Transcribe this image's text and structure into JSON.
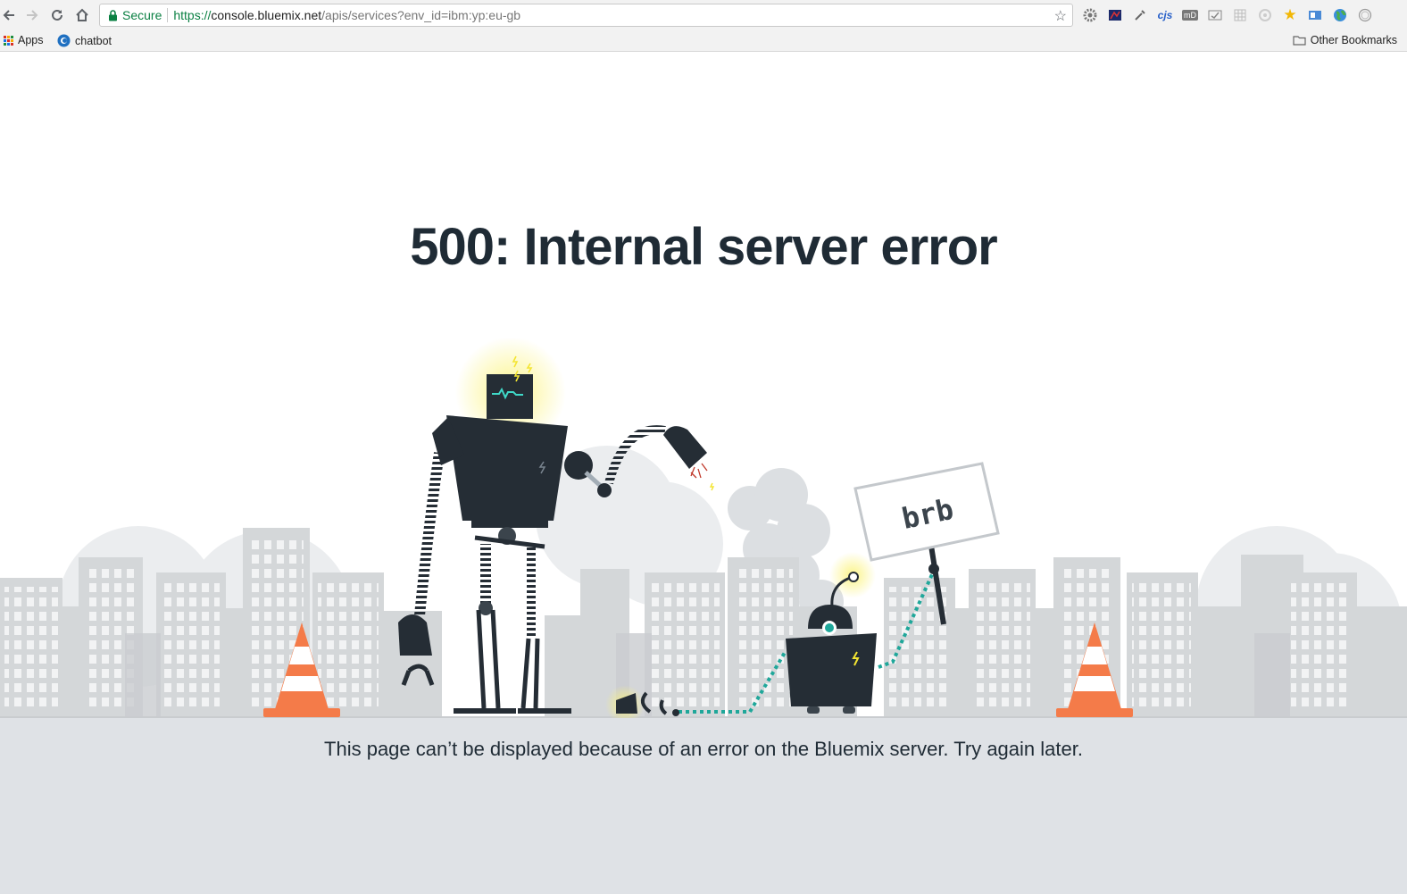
{
  "browser": {
    "security_label": "Secure",
    "url_scheme": "https://",
    "url_host": "console.bluemix.net",
    "url_path": "/apis/services?env_id=ibm:yp:eu-gb",
    "extensions": [
      "gear-extension",
      "dark-extension",
      "eyedropper-extension",
      "cjs-extension",
      "md-extension",
      "check-extension",
      "grid-extension",
      "circle-extension",
      "star-extension",
      "window-extension",
      "globe-extension",
      "ring-extension"
    ],
    "cjs_label": "cjs",
    "md_label": "mD"
  },
  "bookmarks": {
    "apps_label": "Apps",
    "chatbot_label": "chatbot",
    "other_label": "Other Bookmarks"
  },
  "page": {
    "error_code": "500:",
    "error_title": "Internal server error",
    "sign_text": "brb",
    "message": "This page can’t be displayed because of an error on the Bluemix server. Try again later."
  },
  "colors": {
    "accent_dark": "#252d35",
    "teal": "#1fa79a",
    "cone": "#f47b49",
    "buildings": "#d4d7d9",
    "ground": "#dfe2e6",
    "spark": "#f4e532"
  }
}
